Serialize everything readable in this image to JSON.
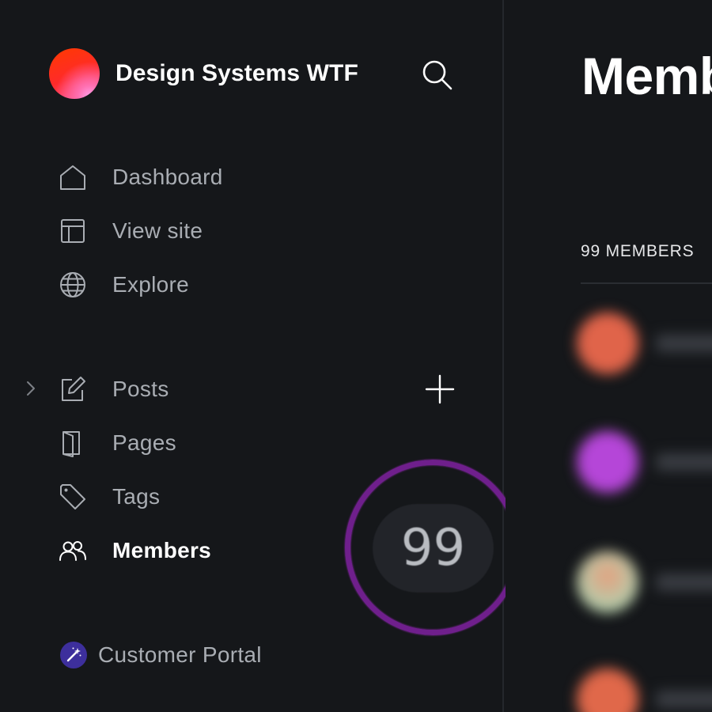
{
  "brand": {
    "name": "Design Systems WTF",
    "logo_icon": "gradient-orb-logo"
  },
  "sidebar": {
    "primary_nav": [
      {
        "label": "Dashboard",
        "icon": "home-icon"
      },
      {
        "label": "View site",
        "icon": "layout-icon"
      },
      {
        "label": "Explore",
        "icon": "globe-icon"
      }
    ],
    "content_nav": [
      {
        "label": "Posts",
        "icon": "edit-icon"
      },
      {
        "label": "Pages",
        "icon": "pages-icon"
      },
      {
        "label": "Tags",
        "icon": "tag-icon"
      },
      {
        "label": "Members",
        "icon": "members-icon",
        "active": true
      }
    ],
    "members_count_badge": "99",
    "customer_portal": {
      "label": "Customer Portal",
      "icon": "magic-wand-icon"
    }
  },
  "main": {
    "title": "Memb",
    "member_count_label": "99 MEMBERS",
    "member_avatar_colors": [
      "#e0644a",
      "#b546d8",
      "#d8b096",
      "#e0684a"
    ]
  },
  "colors": {
    "background": "#15171a",
    "text_muted": "#a9adb3",
    "highlight_ring": "#6f1f8c",
    "badge_bg": "#222429"
  }
}
